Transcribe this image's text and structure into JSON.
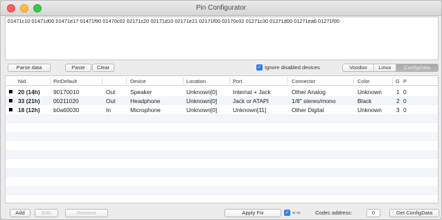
{
  "window": {
    "title": "Pin Configurator"
  },
  "hex_text": "01471c10 01471d00 01471e17 01471f90 01470c02 02171c20 02171d10 02171e21 02171f00 02170c02 01271c30 01271d00 01271ea6 01271f00",
  "toolbar": {
    "parse_label": "Parse data",
    "paste_label": "Paste",
    "clear_label": "Clear",
    "ignore_label": "Ignore disabled devices",
    "ignore_checked": true,
    "segments": [
      "Voodoo",
      "Linux",
      "ConfigData"
    ],
    "active_segment": "ConfigData"
  },
  "table": {
    "headers": [
      "Nid",
      "PinDefault",
      "",
      "Device",
      "Location",
      "Port",
      "Connector",
      "Color",
      "G",
      "P"
    ],
    "rows": [
      {
        "nid": "20 (14h)",
        "pin": "90170010",
        "dir": "Out",
        "device": "Speaker",
        "location": "Unknown[0]",
        "port": "Internal + Jack",
        "connector": "Other Analog",
        "color": "Unknown",
        "g": "1",
        "p": "0"
      },
      {
        "nid": "33 (21h)",
        "pin": "00211020",
        "dir": "Out",
        "device": "Headphone",
        "location": "Unknown[0]",
        "port": "Jack or ATAPI",
        "connector": "1/8\" stereo/mono",
        "color": "Black",
        "g": "2",
        "p": "0"
      },
      {
        "nid": "18 (12h)",
        "pin": "b0a60030",
        "dir": "In",
        "device": "Microphone",
        "location": "Unknown[0]",
        "port": "Unknown[11]",
        "connector": "Other Digital",
        "color": "Unknown",
        "g": "3",
        "p": "0"
      }
    ]
  },
  "bottom": {
    "add_label": "Add",
    "edit_label": "Edit",
    "remove_label": "Remove",
    "apply_fix_label": "Apply Fix",
    "swap_label": "<->",
    "swap_checked": true,
    "codec_label": "Codec address:",
    "codec_value": "0",
    "get_config_label": "Get ConfigData"
  }
}
